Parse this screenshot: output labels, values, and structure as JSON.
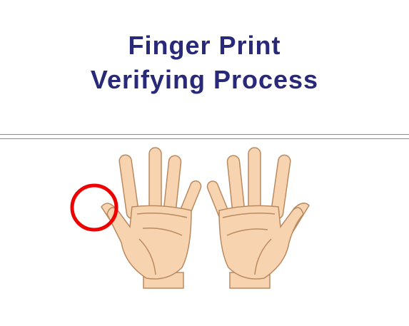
{
  "title": {
    "line1": "Finger Print",
    "line2": "Verifying Process"
  },
  "colors": {
    "title": "#29297a",
    "highlight": "#ee0000",
    "skin": "#f8d3b0",
    "skin_outline": "#b98a60"
  },
  "illustration": {
    "icon": "two-palms-icon",
    "highlight": "left-thumb-circle"
  }
}
